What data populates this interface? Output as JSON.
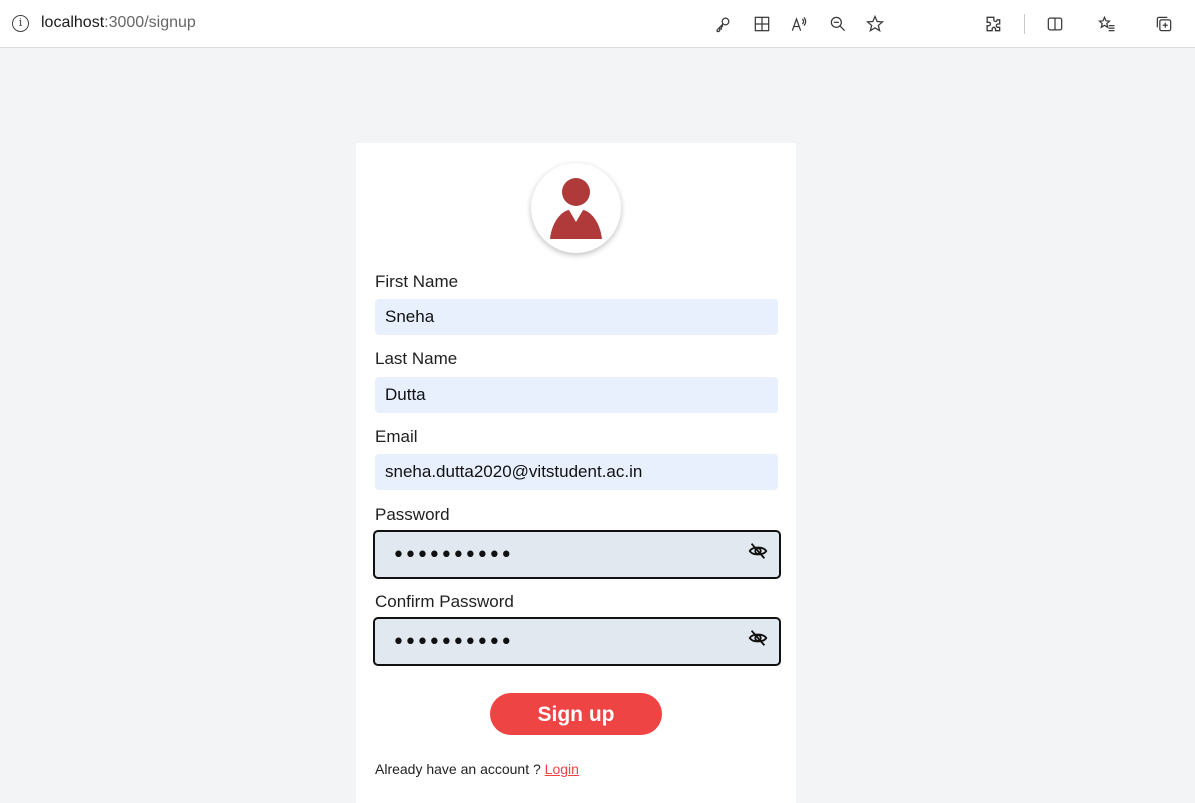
{
  "browser": {
    "url_host": "localhost",
    "url_rest": ":3000/signup",
    "icons": [
      "info-icon",
      "key-icon",
      "grid-add-icon",
      "read-aloud-icon",
      "zoom-out-icon",
      "favorite-star-icon",
      "extensions-icon",
      "split-screen-icon",
      "favorites-list-icon",
      "collections-icon"
    ]
  },
  "form": {
    "avatar_icon": "user-avatar-icon",
    "first_name": {
      "label": "First Name",
      "value": "Sneha"
    },
    "last_name": {
      "label": "Last Name",
      "value": "Dutta"
    },
    "email": {
      "label": "Email",
      "value": "sneha.dutta2020@vitstudent.ac.in"
    },
    "password": {
      "label": "Password",
      "value": "••••••••••"
    },
    "confirm_password": {
      "label": "Confirm Password",
      "value": "••••••••••"
    },
    "submit_label": "Sign up",
    "footer_prompt": "Already have an account ? ",
    "login_label": "Login"
  },
  "colors": {
    "accent": "#ef4444",
    "avatar": "#b03a3a",
    "autofill": "#e8f0fe",
    "password_bg": "#e2e8f0"
  }
}
